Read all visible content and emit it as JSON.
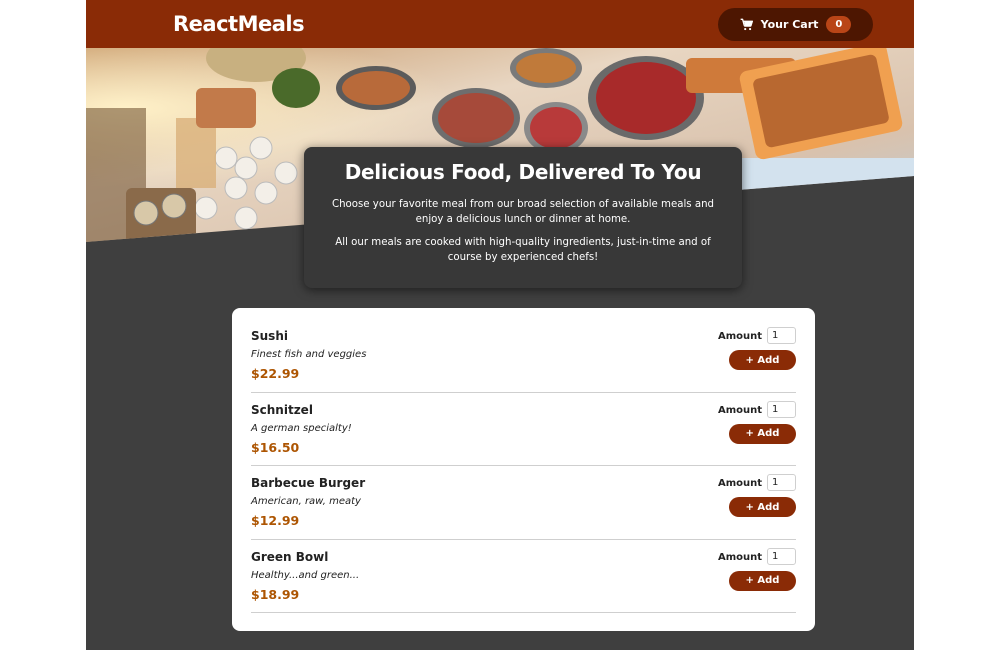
{
  "header": {
    "logo": "ReactMeals",
    "cart": {
      "label": "Your Cart",
      "count": "0",
      "icon": "cart-icon"
    }
  },
  "summary": {
    "title": "Delicious Food, Delivered To You",
    "paragraph1": "Choose your favorite meal from our broad selection of available meals and enjoy a delicious lunch or dinner at home.",
    "paragraph2": "All our meals are cooked with high-quality ingredients, just-in-time and of course by experienced chefs!"
  },
  "meals": [
    {
      "name": "Sushi",
      "description": "Finest fish and veggies",
      "price": "$22.99",
      "amount_label": "Amount",
      "amount": "1",
      "add_label": "+ Add"
    },
    {
      "name": "Schnitzel",
      "description": "A german specialty!",
      "price": "$16.50",
      "amount_label": "Amount",
      "amount": "1",
      "add_label": "+ Add"
    },
    {
      "name": "Barbecue Burger",
      "description": "American, raw, meaty",
      "price": "$12.99",
      "amount_label": "Amount",
      "amount": "1",
      "add_label": "+ Add"
    },
    {
      "name": "Green Bowl",
      "description": "Healthy...and green...",
      "price": "$18.99",
      "amount_label": "Amount",
      "amount": "1",
      "add_label": "+ Add"
    }
  ],
  "colors": {
    "header": "#8a2b06",
    "cart_button": "#4d1601",
    "badge": "#b94517",
    "background": "#3f3f3f",
    "price": "#ad5502"
  }
}
